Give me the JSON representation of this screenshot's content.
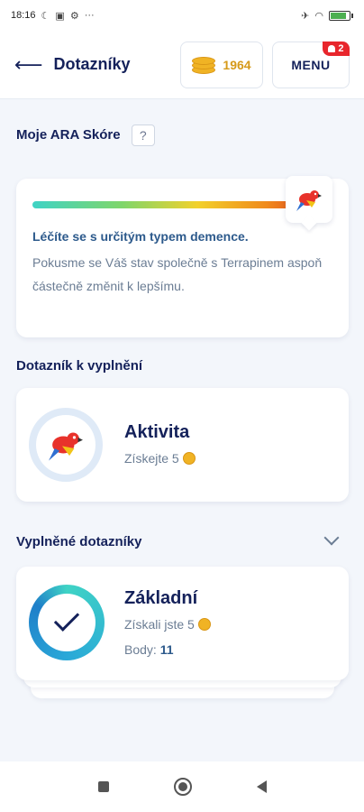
{
  "status_bar": {
    "time": "18:16",
    "more": "···"
  },
  "header": {
    "title": "Dotazníky",
    "coins": "1964",
    "menu_label": "MENU",
    "notifications": "2"
  },
  "score": {
    "section_title": "Moje ARA Skóre",
    "help_label": "?",
    "headline": "Léčíte se s určitým typem demence.",
    "text": "Pokusme se Váš stav společně s Terrapinem aspoň částečně změnit k lepšímu.",
    "level": 0.93
  },
  "to_fill": {
    "section_title": "Dotazník k vyplnění",
    "title": "Aktivita",
    "reward_text": "Získejte 5"
  },
  "filled": {
    "section_title": "Vyplněné dotazníky",
    "title": "Základní",
    "reward_text": "Získali jste 5",
    "points_label": "Body:",
    "points_value": "11"
  },
  "colors": {
    "primary": "#14215a",
    "coin": "#f0b324",
    "badge": "#e8262c"
  },
  "icons": [
    "back-arrow-icon",
    "coins-icon",
    "bell-icon",
    "parrot-icon",
    "check-icon",
    "chevron-down-icon",
    "coin-icon"
  ]
}
